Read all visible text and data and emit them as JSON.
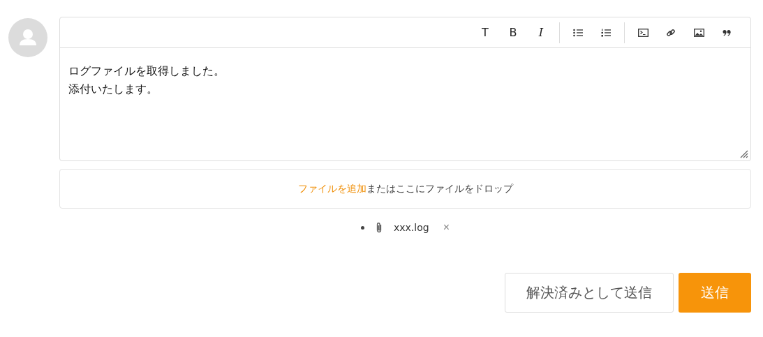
{
  "toolbar": [
    [
      {
        "kind": "text",
        "label": "T"
      },
      {
        "kind": "text",
        "label": "B"
      },
      {
        "kind": "italic-text",
        "label": "I"
      }
    ],
    [
      {
        "kind": "bullet-list"
      },
      {
        "kind": "numbered-list"
      }
    ],
    [
      {
        "kind": "code"
      },
      {
        "kind": "link"
      },
      {
        "kind": "image"
      },
      {
        "kind": "quote"
      }
    ]
  ],
  "editor": {
    "lines": [
      "ログファイルを取得しました。",
      "添付いたします。"
    ]
  },
  "dropzone": {
    "link": "ファイルを追加",
    "text": "またはここにファイルをドロップ"
  },
  "attachments": [
    {
      "name": "xxx.log",
      "remove": "×"
    }
  ],
  "buttons": [
    {
      "kind": "secondary",
      "label": "解決済みとして送信"
    },
    {
      "kind": "primary",
      "label": "送信"
    }
  ]
}
